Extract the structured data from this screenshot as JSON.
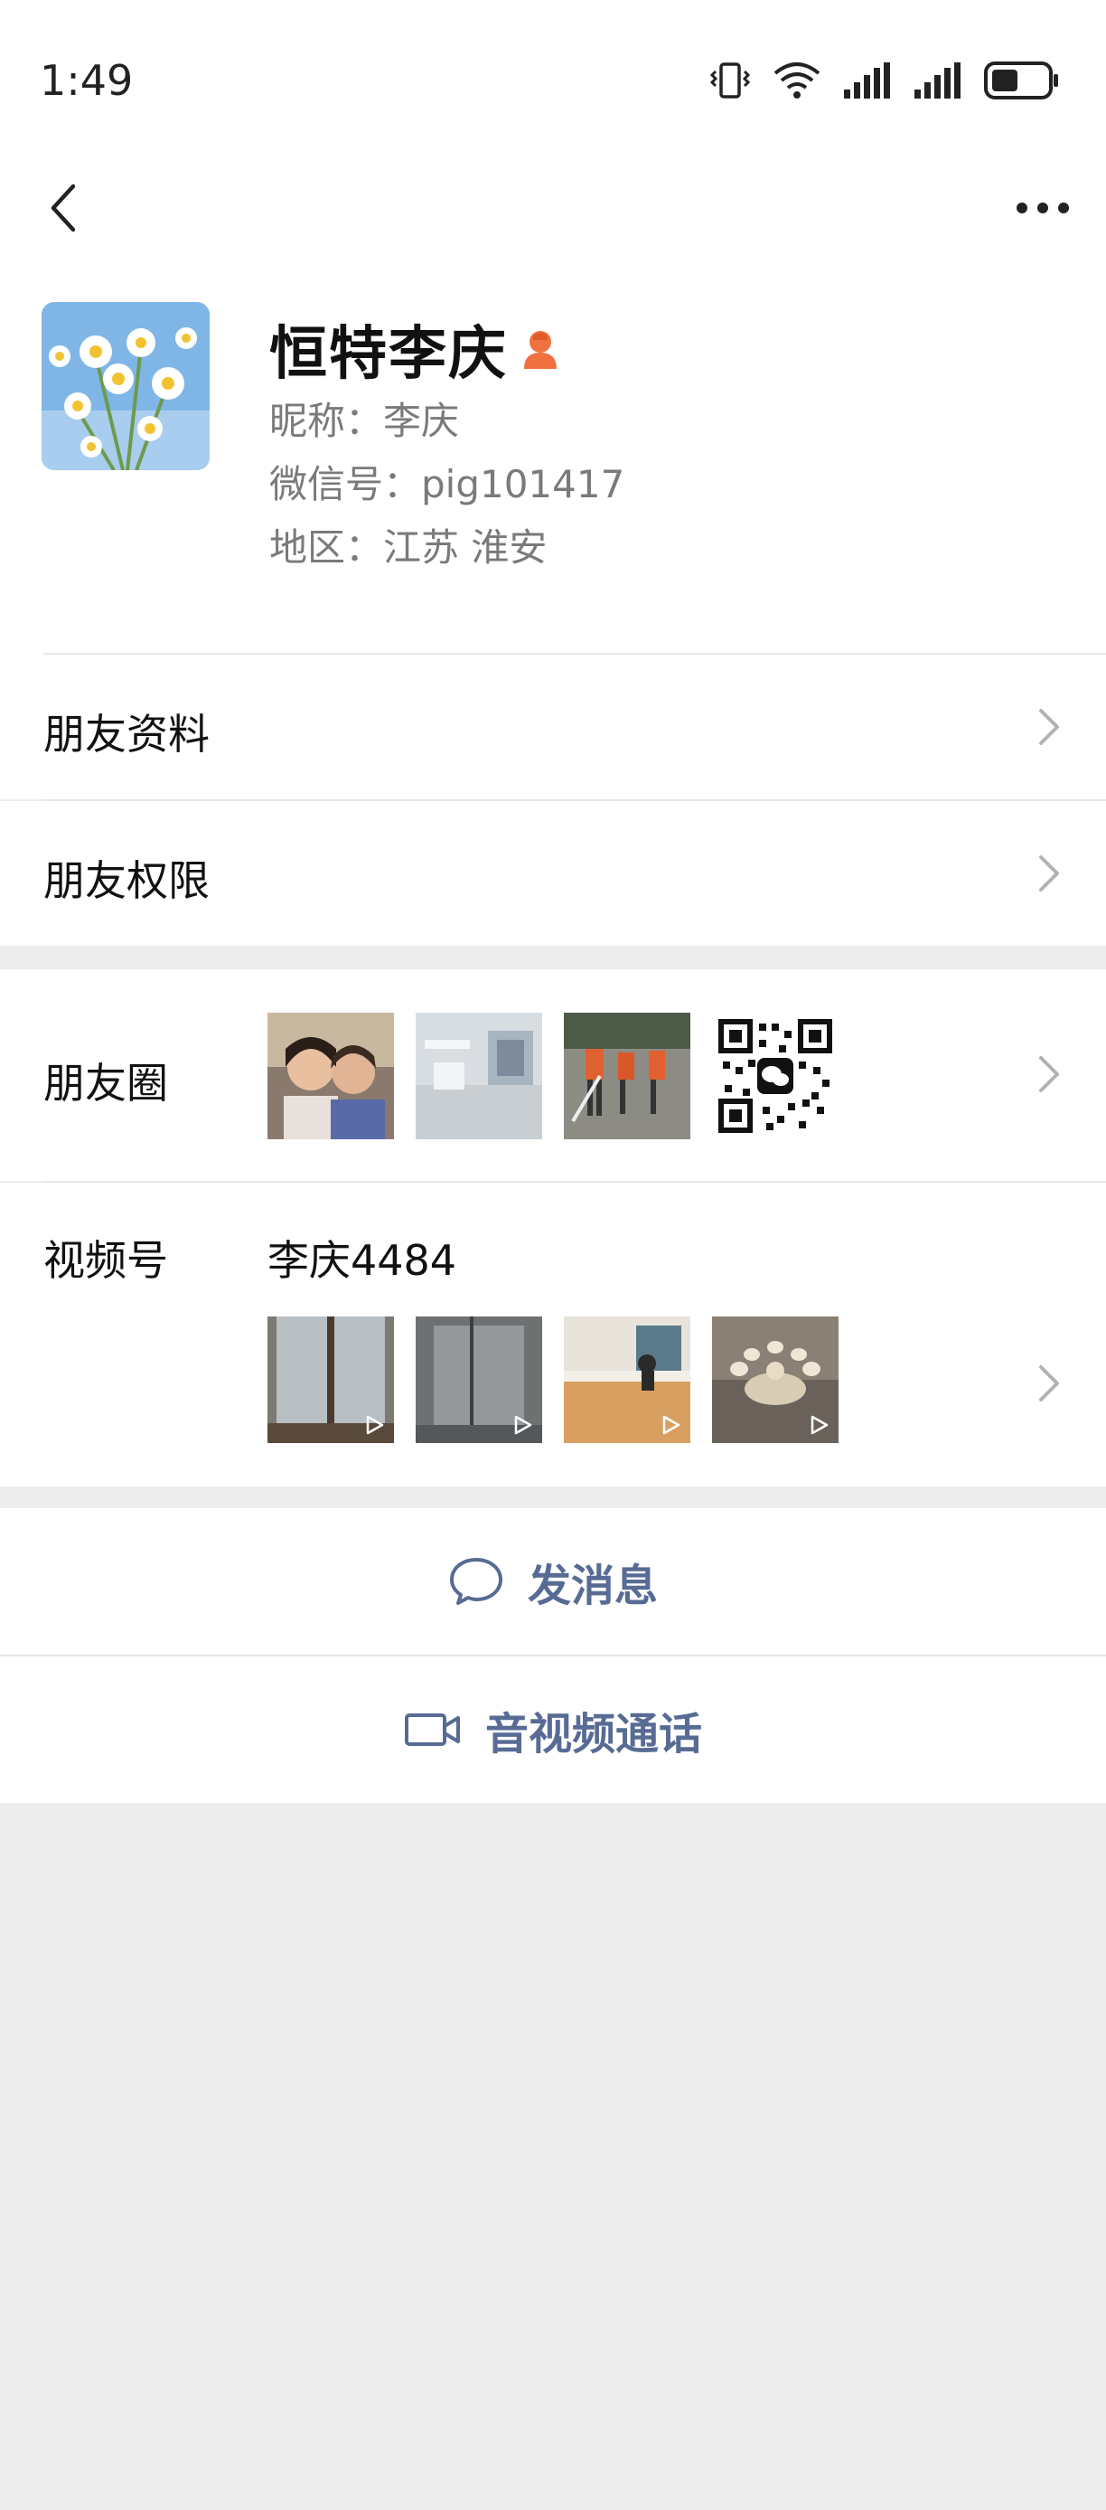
{
  "status_bar": {
    "time": "1:49"
  },
  "profile": {
    "name": "恒特李庆",
    "nickname": "昵称：李庆",
    "wechat_id": "微信号：pig101417",
    "region": "地区：江苏  淮安"
  },
  "menu": {
    "friend_info": "朋友资料",
    "friend_permissions": "朋友权限"
  },
  "moments": {
    "label": "朋友圈"
  },
  "channels": {
    "label": "视频号",
    "name": "李庆4484"
  },
  "actions": {
    "message": "发消息",
    "call": "音视频通话"
  },
  "colors": {
    "link_blue": "#576b95",
    "background": "#ededed",
    "badge_orange": "#f07040"
  }
}
